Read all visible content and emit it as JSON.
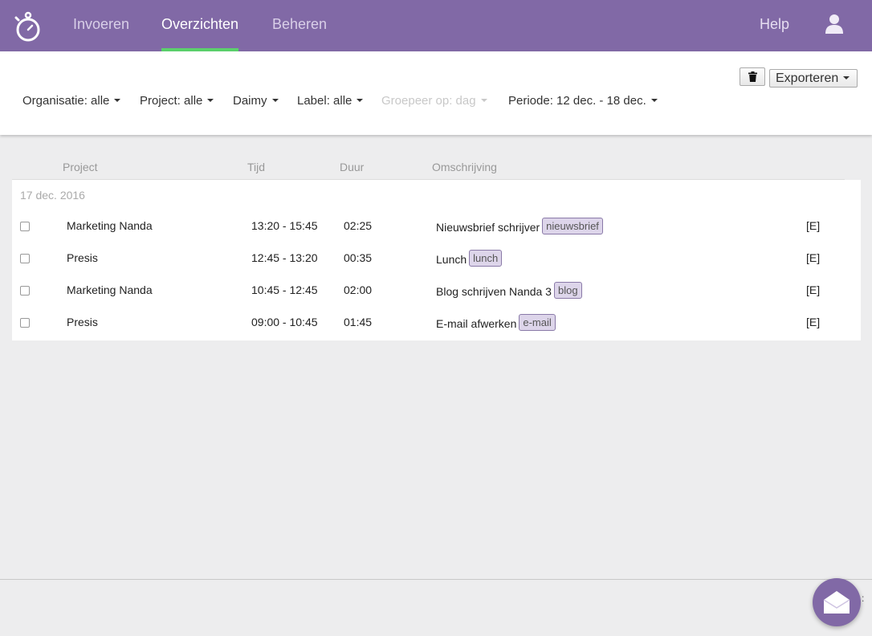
{
  "nav": {
    "items": [
      {
        "label": "Invoeren",
        "active": false
      },
      {
        "label": "Overzichten",
        "active": true
      },
      {
        "label": "Beheren",
        "active": false
      }
    ],
    "help": "Help",
    "accent_color": "#8169a6",
    "active_underline_color": "#5ad06b",
    "logo_icon": "stopwatch-icon",
    "user_icon": "user-icon"
  },
  "filters": {
    "organisation": "Organisatie: alle",
    "project": "Project: alle",
    "user": "Daimy",
    "label": "Label: alle",
    "group_by": "Groepeer op: dag",
    "period": "Periode: 12 dec. - 18 dec."
  },
  "actions": {
    "delete_icon": "trash-icon",
    "export_label": "Exporteren"
  },
  "table": {
    "columns": {
      "project": "Project",
      "time": "Tijd",
      "duration": "Duur",
      "description": "Omschrijving"
    },
    "date": "17 dec. 2016",
    "rows": [
      {
        "project": "Marketing Nanda",
        "time": "13:20 - 15:45",
        "duration": "02:25",
        "description": "Nieuwsbrief schrijver",
        "tag": "nieuwsbrief",
        "edit": "[E]"
      },
      {
        "project": "Presis",
        "time": "12:45 - 13:20",
        "duration": "00:35",
        "description": "Lunch",
        "tag": "lunch",
        "edit": "[E]"
      },
      {
        "project": "Marketing Nanda",
        "time": "10:45 - 12:45",
        "duration": "02:00",
        "description": "Blog schrijven Nanda 3",
        "tag": "blog",
        "edit": "[E]"
      },
      {
        "project": "Presis",
        "time": "09:00 - 10:45",
        "duration": "01:45",
        "description": "E-mail afwerken",
        "tag": "e-mail",
        "edit": "[E]"
      }
    ]
  },
  "footer": {
    "chat_icon": "envelope-icon",
    "edge_mark": ":"
  }
}
